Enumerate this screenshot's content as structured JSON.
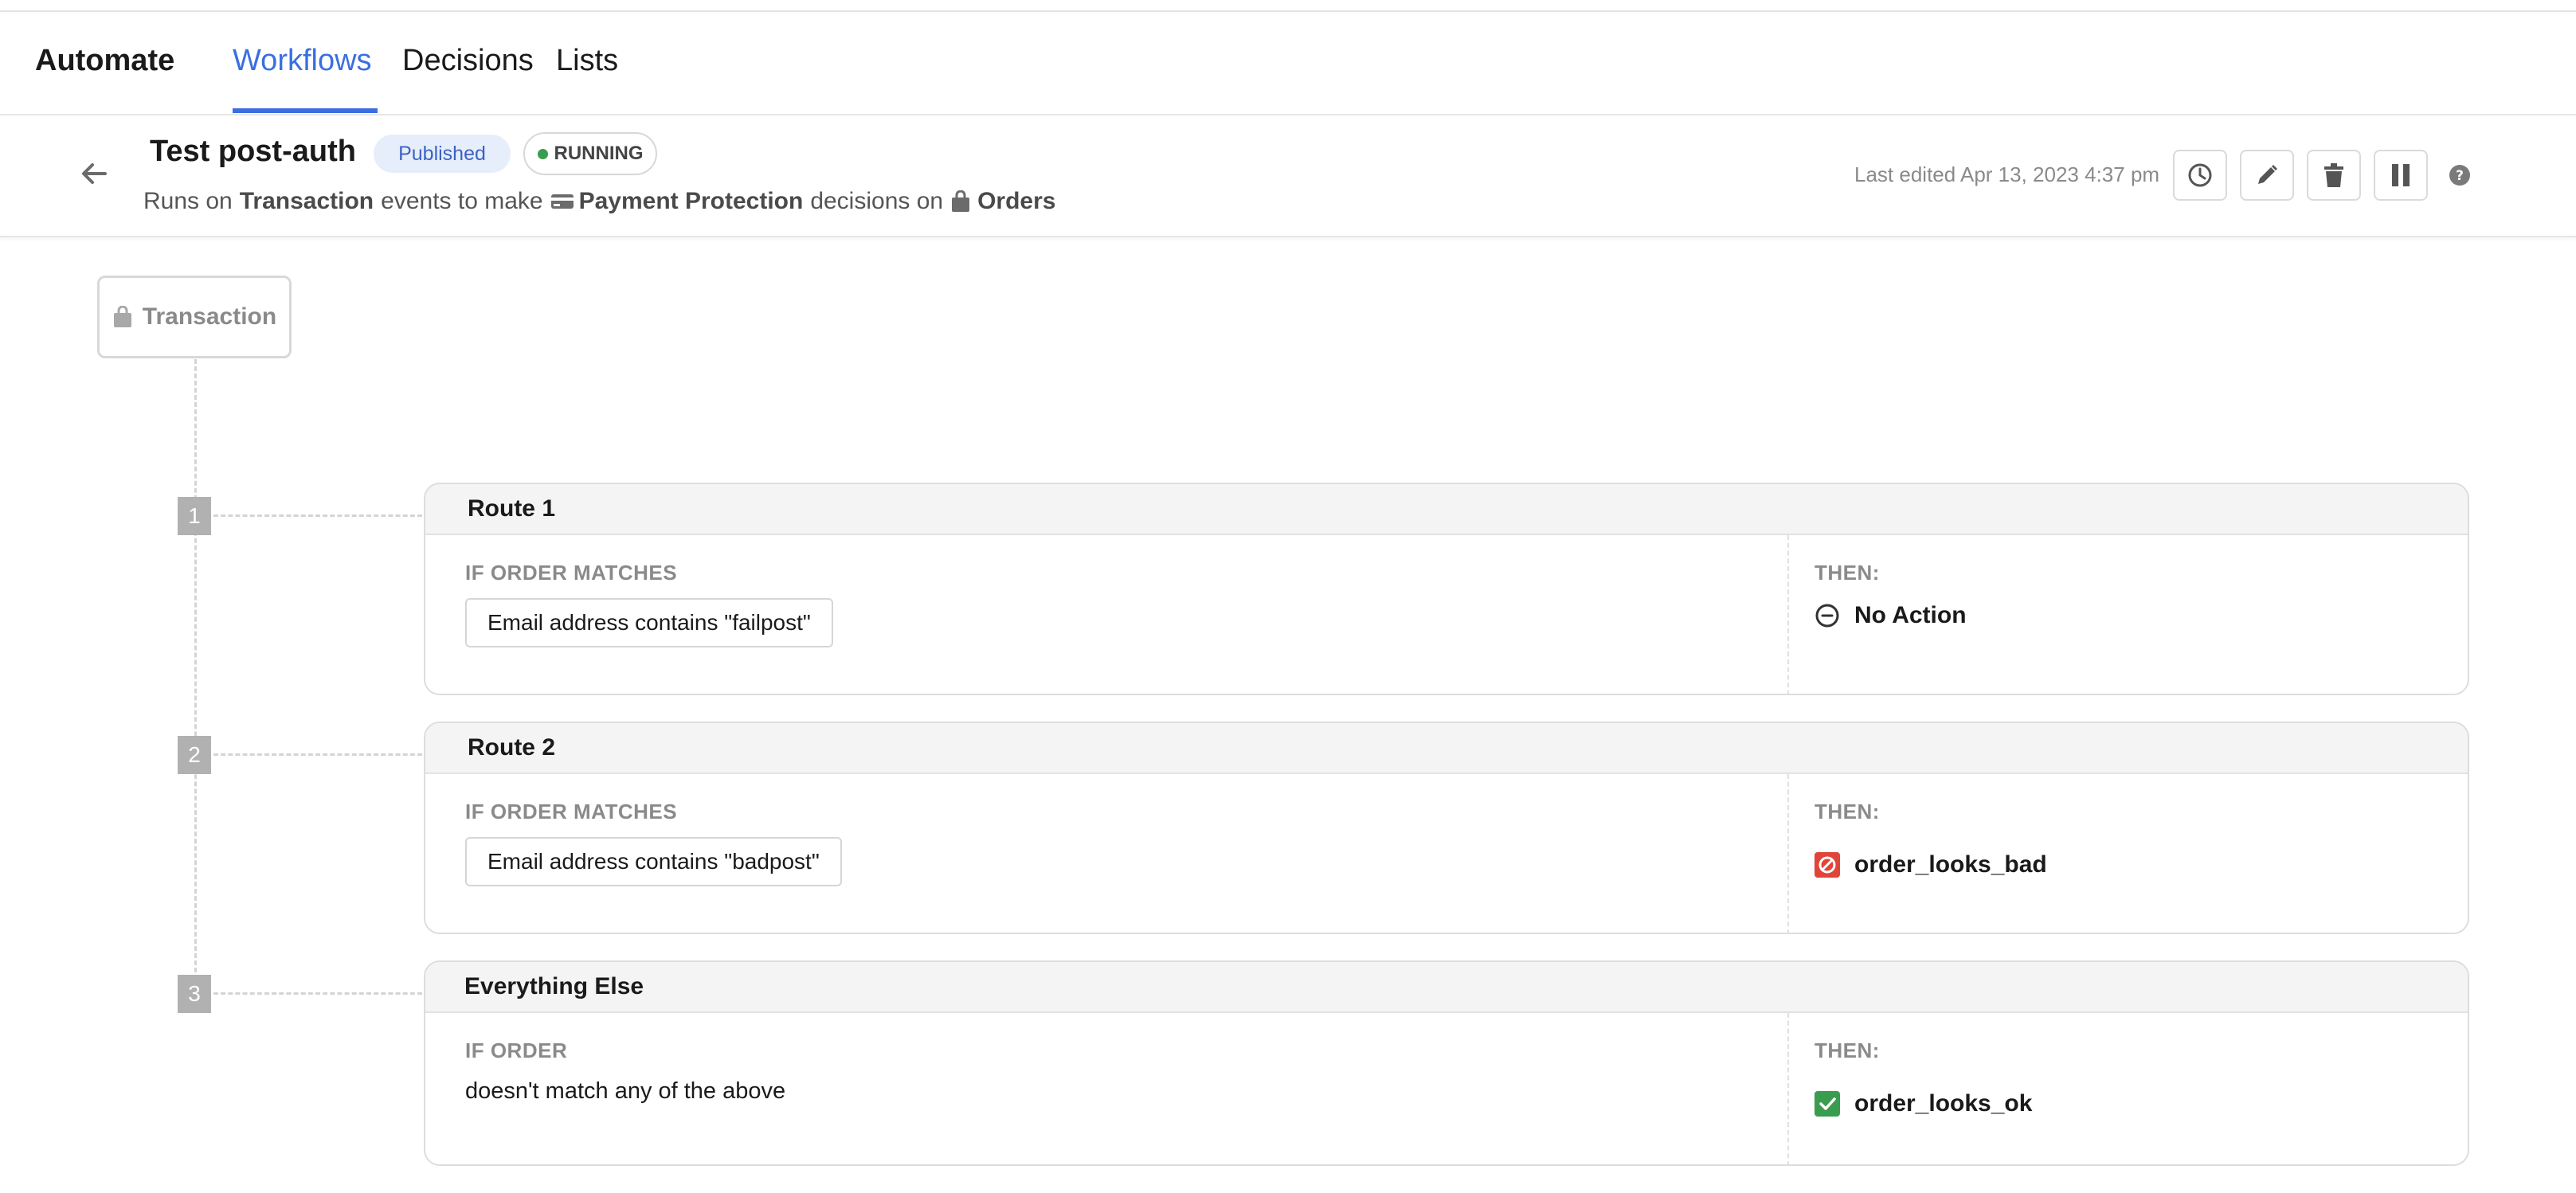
{
  "nav": {
    "brand": "Automate",
    "tabs": [
      {
        "label": "Workflows",
        "active": true
      },
      {
        "label": "Decisions",
        "active": false
      },
      {
        "label": "Lists",
        "active": false
      }
    ]
  },
  "workflow": {
    "title": "Test post-auth",
    "status_badge": "Published",
    "state_badge": "RUNNING",
    "subline": {
      "prefix": "Runs on",
      "event": "Transaction",
      "middle": "events to make",
      "decision_type": "Payment Protection",
      "suffix": "decisions on",
      "object": "Orders"
    },
    "last_edited": "Last edited Apr 13, 2023 4:37 pm"
  },
  "colors": {
    "accent": "#3b6fe0",
    "running": "#3a9c4f",
    "bad": "#e0453a",
    "ok": "#3a9c4f"
  },
  "trigger": {
    "label": "Transaction",
    "icon": "bag-icon"
  },
  "routes": [
    {
      "number": "1",
      "title": "Route 1",
      "condition_label": "IF ORDER MATCHES",
      "condition": "Email address contains \"failpost\"",
      "then_label": "THEN:",
      "action": "No Action",
      "action_icon": "no-action-icon"
    },
    {
      "number": "2",
      "title": "Route 2",
      "condition_label": "IF ORDER MATCHES",
      "condition": "Email address contains \"badpost\"",
      "then_label": "THEN:",
      "action": "order_looks_bad",
      "action_icon": "block-icon"
    },
    {
      "number": "3",
      "title": "Everything Else",
      "condition_label": "IF ORDER",
      "condition": "doesn't match any of the above",
      "then_label": "THEN:",
      "action": "order_looks_ok",
      "action_icon": "check-icon"
    }
  ]
}
